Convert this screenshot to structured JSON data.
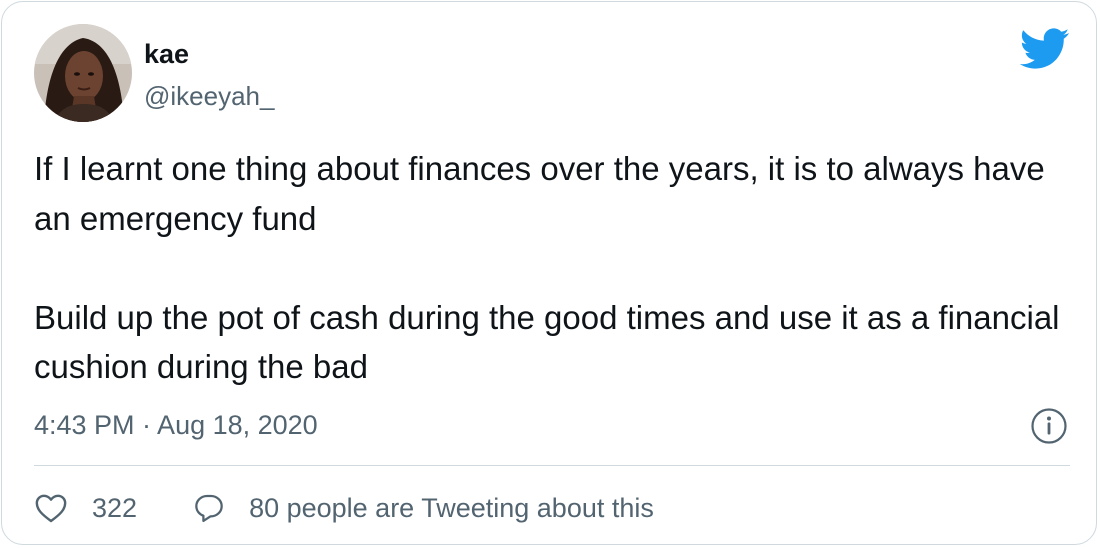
{
  "author": {
    "name": "kae",
    "handle": "@ikeeyah_",
    "avatar_icon": "profile-photo"
  },
  "tweet": {
    "paragraphs": [
      "If I learnt one thing about finances over the years, it is to always have an emergency fund",
      "Build up the pot of cash during the good times and use it as a financial cushion during the bad"
    ],
    "timestamp": "4:43 PM · Aug 18, 2020"
  },
  "actions": {
    "like_count": "322",
    "reply_text": "80 people are Tweeting about this"
  },
  "icons": {
    "brand": "twitter-bird-icon",
    "info": "info-icon",
    "like": "heart-icon",
    "reply": "speech-bubble-icon"
  },
  "colors": {
    "brand_blue": "#1d9bf0",
    "secondary_text": "#536471",
    "primary_text": "#0f1419",
    "border": "#cfd9de"
  }
}
